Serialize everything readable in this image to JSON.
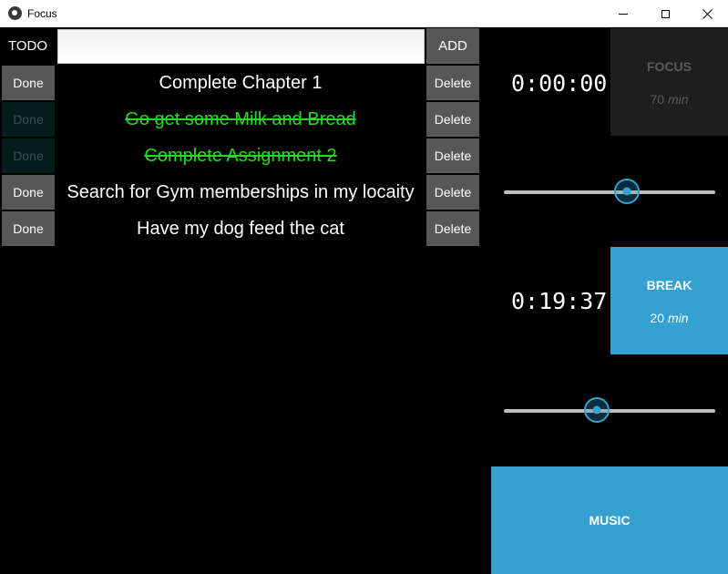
{
  "window": {
    "title": "Focus"
  },
  "todo": {
    "label": "TODO",
    "input_value": "",
    "add_label": "ADD"
  },
  "tasks": [
    {
      "text": "Complete Chapter 1",
      "done_label": "Done",
      "delete_label": "Delete",
      "completed": false
    },
    {
      "text": "Go get some Milk and Bread",
      "done_label": "Done",
      "delete_label": "Delete",
      "completed": true
    },
    {
      "text": "Complete Assignment 2",
      "done_label": "Done",
      "delete_label": "Delete",
      "completed": true
    },
    {
      "text": "Search for Gym memberships in my locaity",
      "done_label": "Done",
      "delete_label": "Delete",
      "completed": false
    },
    {
      "text": "Have my dog feed the cat",
      "done_label": "Done",
      "delete_label": "Delete",
      "completed": false
    }
  ],
  "focus": {
    "timer": "0:00:00",
    "title": "FOCUS",
    "minutes": "70",
    "unit": "min",
    "slider_fraction": 0.58
  },
  "break": {
    "timer": "0:19:37",
    "title": "BREAK",
    "minutes": "20",
    "unit": "min",
    "slider_fraction": 0.44
  },
  "music": {
    "label": "MUSIC"
  },
  "colors": {
    "accent": "#34a1d0",
    "completed_text": "#27d827",
    "button": "#575757",
    "background": "#000000"
  }
}
